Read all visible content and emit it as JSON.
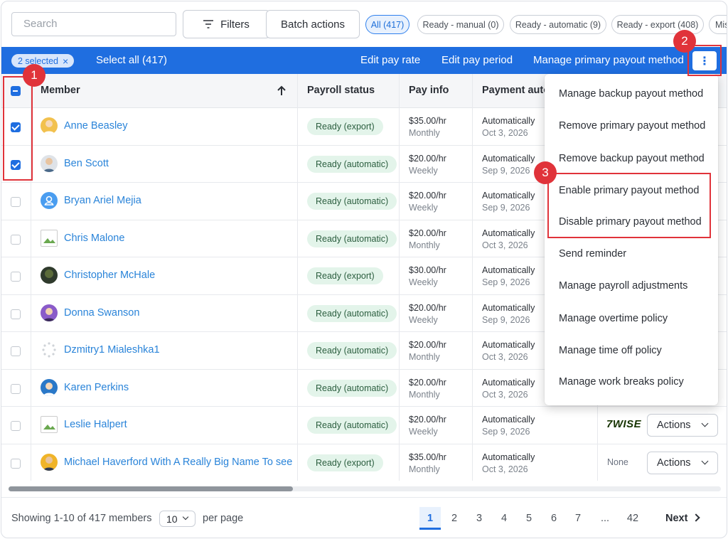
{
  "toolbar": {
    "search_placeholder": "Search",
    "filters_label": "Filters",
    "batch_actions_label": "Batch actions",
    "chips": [
      "All (417)",
      "Ready - manual (0)",
      "Ready - automatic (9)",
      "Ready - export (408)",
      "Mis"
    ]
  },
  "selection_bar": {
    "selected_label": "2 selected",
    "clear_icon": "close-icon",
    "select_all_label": "Select all (417)",
    "edit_pay_rate": "Edit pay rate",
    "edit_pay_period": "Edit pay period",
    "manage_primary": "Manage primary payout method",
    "more_label": "⋮"
  },
  "table": {
    "headers": {
      "member": "Member",
      "payroll_status": "Payroll status",
      "pay_info": "Pay info",
      "payment": "Payment auto",
      "sort_icon": "arrow-up-icon"
    },
    "rows": [
      {
        "name": "Anne Beasley",
        "status": "Ready (export)",
        "rate": "$35.00/hr",
        "period": "Monthly",
        "auto": "Automatically",
        "date": "Oct 3, 2026",
        "checked": true
      },
      {
        "name": "Ben Scott",
        "status": "Ready (automatic)",
        "rate": "$20.00/hr",
        "period": "Weekly",
        "auto": "Automatically",
        "date": "Sep 9, 2026",
        "checked": true
      },
      {
        "name": "Bryan Ariel Mejia",
        "status": "Ready (automatic)",
        "rate": "$20.00/hr",
        "period": "Weekly",
        "auto": "Automatically",
        "date": "Sep 9, 2026",
        "checked": false
      },
      {
        "name": "Chris Malone",
        "status": "Ready (automatic)",
        "rate": "$20.00/hr",
        "period": "Monthly",
        "auto": "Automatically",
        "date": "Oct 3, 2026",
        "checked": false
      },
      {
        "name": "Christopher McHale",
        "status": "Ready (export)",
        "rate": "$30.00/hr",
        "period": "Weekly",
        "auto": "Automatically",
        "date": "Sep 9, 2026",
        "checked": false
      },
      {
        "name": "Donna Swanson",
        "status": "Ready (automatic)",
        "rate": "$20.00/hr",
        "period": "Weekly",
        "auto": "Automatically",
        "date": "Sep 9, 2026",
        "checked": false
      },
      {
        "name": "Dzmitry1 Mialeshka1",
        "status": "Ready (automatic)",
        "rate": "$20.00/hr",
        "period": "Monthly",
        "auto": "Automatically",
        "date": "Oct 3, 2026",
        "checked": false
      },
      {
        "name": "Karen Perkins",
        "status": "Ready (automatic)",
        "rate": "$20.00/hr",
        "period": "Monthly",
        "auto": "Automatically",
        "date": "Oct 3, 2026",
        "checked": false
      },
      {
        "name": "Leslie Halpert",
        "status": "Ready (automatic)",
        "rate": "$20.00/hr",
        "period": "Weekly",
        "auto": "Automatically",
        "date": "Sep 9, 2026",
        "checked": false,
        "payout": "7WISE",
        "action": "Actions"
      },
      {
        "name": "Michael Haverford With A Really Big Name To see",
        "status": "Ready (export)",
        "rate": "$35.00/hr",
        "period": "Monthly",
        "auto": "Automatically",
        "date": "Oct 3, 2026",
        "checked": false,
        "payout": "None",
        "action": "Actions"
      }
    ]
  },
  "dropdown": {
    "items": [
      "Manage backup payout method",
      "Remove primary payout method",
      "Remove backup payout method",
      "Enable primary payout method",
      "Disable primary payout method",
      "Send reminder",
      "Manage payroll adjustments",
      "Manage overtime policy",
      "Manage time off policy",
      "Manage work breaks policy"
    ]
  },
  "footer": {
    "showing": "Showing 1-10 of 417 members",
    "per_page_value": "10",
    "per_page_label": "per page",
    "pages": [
      "1",
      "2",
      "3",
      "4",
      "5",
      "6",
      "7",
      "...",
      "42"
    ],
    "current_page": "1",
    "next_label": "Next"
  },
  "annotations": [
    "1",
    "2",
    "3"
  ],
  "colors": {
    "accent": "#1f6ee0",
    "link": "#2a84d9",
    "status_bg": "#e3f4ea",
    "annotation": "#e0333a"
  }
}
